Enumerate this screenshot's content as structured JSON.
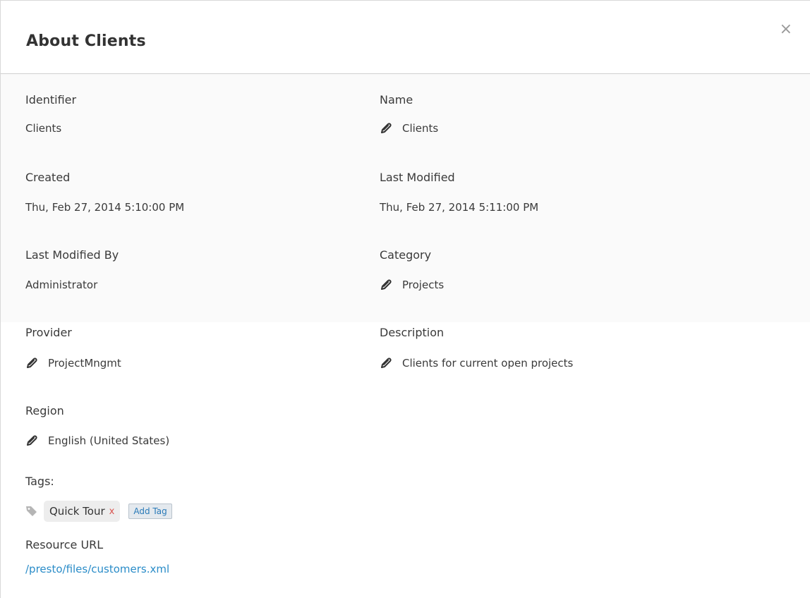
{
  "dialog": {
    "title": "About Clients",
    "close_glyph": "×"
  },
  "fields": {
    "identifier": {
      "label": "Identifier",
      "value": "Clients"
    },
    "name": {
      "label": "Name",
      "value": "Clients"
    },
    "created": {
      "label": "Created",
      "value": "Thu, Feb 27, 2014 5:10:00 PM"
    },
    "last_modified": {
      "label": "Last Modified",
      "value": "Thu, Feb 27, 2014 5:11:00 PM"
    },
    "last_modified_by": {
      "label": "Last Modified By",
      "value": "Administrator"
    },
    "category": {
      "label": "Category",
      "value": "Projects"
    },
    "provider": {
      "label": "Provider",
      "value": "ProjectMngmt"
    },
    "description": {
      "label": "Description",
      "value": "Clients for current open projects"
    },
    "region": {
      "label": "Region",
      "value": "English (United States)"
    }
  },
  "tags": {
    "label": "Tags:",
    "items": [
      {
        "label": "Quick Tour",
        "remove": "x"
      }
    ],
    "add_label": "Add Tag"
  },
  "resource": {
    "label": "Resource URL",
    "url": "/presto/files/customers.xml"
  },
  "colors": {
    "link": "#2a8cc8",
    "remove": "#d9534f"
  },
  "icons": {
    "edit": "pencil-icon",
    "tag": "tag-icon",
    "close": "close-icon"
  }
}
